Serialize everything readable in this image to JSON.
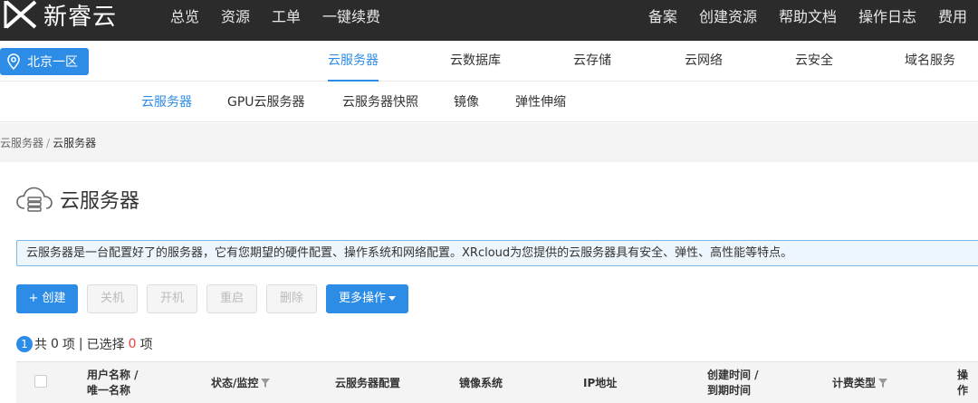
{
  "brand": {
    "name": "新睿云"
  },
  "topnav": {
    "items": [
      "总览",
      "资源",
      "工单",
      "一键续费"
    ]
  },
  "topright": {
    "items": [
      "备案",
      "创建资源",
      "帮助文档",
      "操作日志",
      "费用"
    ]
  },
  "region": {
    "label": "北京一区"
  },
  "product_tabs": [
    {
      "label": "云服务器",
      "active": true
    },
    {
      "label": "云数据库"
    },
    {
      "label": "云存储"
    },
    {
      "label": "云网络"
    },
    {
      "label": "云安全"
    },
    {
      "label": "域名服务"
    }
  ],
  "sub_tabs": [
    {
      "label": "云服务器",
      "active": true
    },
    {
      "label": "GPU云服务器"
    },
    {
      "label": "云服务器快照"
    },
    {
      "label": "镜像"
    },
    {
      "label": "弹性伸缩"
    }
  ],
  "breadcrumb": {
    "parent": "云服务器",
    "separator": "/",
    "current": "云服务器"
  },
  "page": {
    "title": "云服务器"
  },
  "info_text": "云服务器是一台配置好了的服务器，它有您期望的硬件配置、操作系统和网络配置。XRcloud为您提供的云服务器具有安全、弹性、高性能等特点。",
  "toolbar": {
    "create": "+ 创建",
    "shutdown": "关机",
    "start": "开机",
    "restart": "重启",
    "delete": "删除",
    "more": "更多操作"
  },
  "summary": {
    "badge": "1",
    "total_prefix": "共",
    "total_count": "0",
    "total_suffix": "项",
    "divider": "|",
    "selected_prefix": "已选择",
    "selected_count": "0",
    "selected_suffix": "项"
  },
  "table": {
    "columns": [
      {
        "line1": "用户名称 /",
        "line2": "唯一名称"
      },
      {
        "line1": "状态/监控",
        "filter": true
      },
      {
        "line1": "云服务器配置"
      },
      {
        "line1": "镜像系统"
      },
      {
        "line1": "IP地址"
      },
      {
        "line1": "创建时间 /",
        "line2": "到期时间"
      },
      {
        "line1": "计费类型",
        "filter": true
      },
      {
        "line1": "操作"
      }
    ]
  },
  "colors": {
    "accent": "#2d8ce6",
    "topbar": "#2b2b2b",
    "danger": "#e8433a"
  }
}
